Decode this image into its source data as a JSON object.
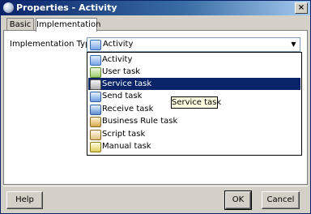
{
  "window": {
    "title": "Properties - Activity",
    "close_label": "×"
  },
  "tabs": [
    {
      "label": "Basic"
    },
    {
      "label": "Implementation"
    }
  ],
  "form": {
    "implementation_type_label": "Implementation Type:",
    "selected_value": "Activity",
    "selected_icon": "activity-icon"
  },
  "dropdown": {
    "items": [
      {
        "label": "Activity",
        "icon": "activity-icon"
      },
      {
        "label": "User task",
        "icon": "user-task-icon"
      },
      {
        "label": "Service task",
        "icon": "service-task-icon",
        "highlighted": true
      },
      {
        "label": "Send task",
        "icon": "send-task-icon"
      },
      {
        "label": "Receive task",
        "icon": "receive-task-icon"
      },
      {
        "label": "Business Rule task",
        "icon": "business-rule-task-icon"
      },
      {
        "label": "Script task",
        "icon": "script-task-icon"
      },
      {
        "label": "Manual task",
        "icon": "manual-task-icon"
      }
    ]
  },
  "tooltip": {
    "text": "Service task"
  },
  "buttons": {
    "help": "Help",
    "ok": "OK",
    "cancel": "Cancel"
  },
  "colors": {
    "title_bar": "#0a246a",
    "selection": "#0a246a",
    "tooltip_bg": "#ffffe1",
    "dialog_bg": "#d4d0c8"
  }
}
